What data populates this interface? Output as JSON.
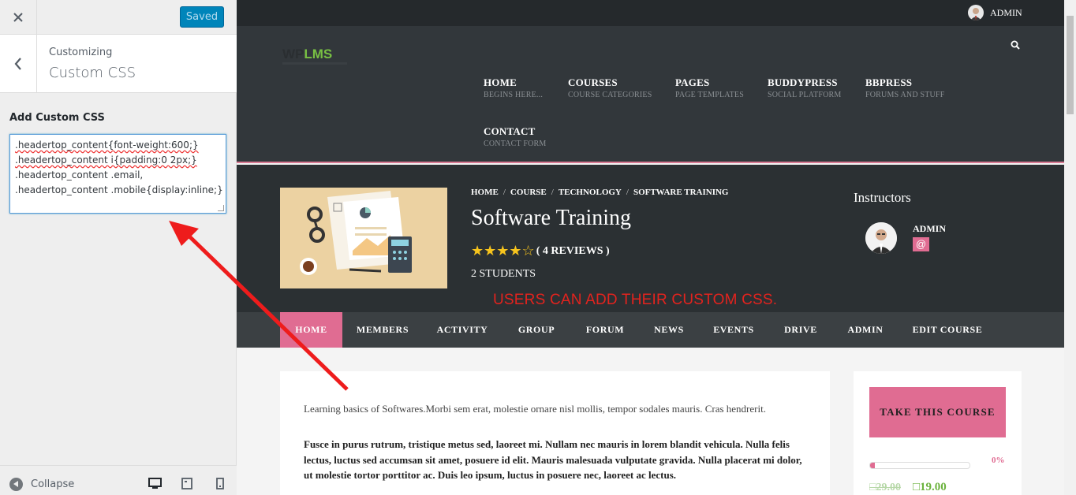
{
  "customizer": {
    "saved_label": "Saved",
    "customizing_label": "Customizing",
    "section_title": "Custom CSS",
    "add_css_label": "Add Custom CSS",
    "css_lines": [
      ".headertop_content{font-weight:600;}",
      ".headertop_content i{padding:0 2px;}",
      ".headertop_content .email,",
      ".headertop_content .mobile{display:inline;}"
    ],
    "collapse_label": "Collapse"
  },
  "site": {
    "admin_label": "ADMIN",
    "logo_wp": "WP",
    "logo_lms": "LMS",
    "nav": [
      {
        "title": "HOME",
        "sub": "BEGINS HERE..."
      },
      {
        "title": "COURSES",
        "sub": "COURSE CATEGORIES"
      },
      {
        "title": "PAGES",
        "sub": "PAGE TEMPLATES"
      },
      {
        "title": "BUDDYPRESS",
        "sub": "SOCIAL PLATFORM"
      },
      {
        "title": "BBPRESS",
        "sub": "FORUMS AND STUFF"
      },
      {
        "title": "CONTACT",
        "sub": "CONTACT FORM"
      }
    ]
  },
  "course": {
    "breadcrumb": [
      "HOME",
      "COURSE",
      "TECHNOLOGY",
      "SOFTWARE TRAINING"
    ],
    "title": "Software Training",
    "stars": "★★★★☆",
    "reviews": "( 4 REVIEWS )",
    "students": "2 STUDENTS",
    "instructors_title": "Instructors",
    "instructor_name": "ADMIN",
    "instructor_at": "@",
    "annotation": "USERS CAN ADD THEIR CUSTOM CSS.",
    "tabs": [
      "HOME",
      "MEMBERS",
      "ACTIVITY",
      "GROUP",
      "FORUM",
      "NEWS",
      "EVENTS",
      "DRIVE",
      "ADMIN",
      "EDIT COURSE"
    ],
    "description": "Learning basics of Softwares.Morbi sem erat, molestie ornare nisl mollis, tempor sodales mauris. Cras hendrerit.",
    "description_bold": "Fusce in purus rutrum, tristique metus sed, laoreet mi. Nullam nec mauris in lorem blandit vehicula. Nulla felis lectus, luctus sed accumsan sit amet, posuere id elit. Mauris malesuada vulputate gravida. Nulla placerat mi dolor, ut molestie tortor porttitor ac. Duis leo ipsum, luctus in posuere nec, laoreet ac lectus.",
    "take_course_label": "TAKE THIS COURSE",
    "progress_percent": 5,
    "progress_label": "0%",
    "price_old": "□29.00",
    "price_new": "□19.00"
  },
  "colors": {
    "accent_pink": "#e06c92",
    "wp_blue": "#0085ba",
    "annotation_red": "#e3231e",
    "logo_green": "#78c043"
  }
}
